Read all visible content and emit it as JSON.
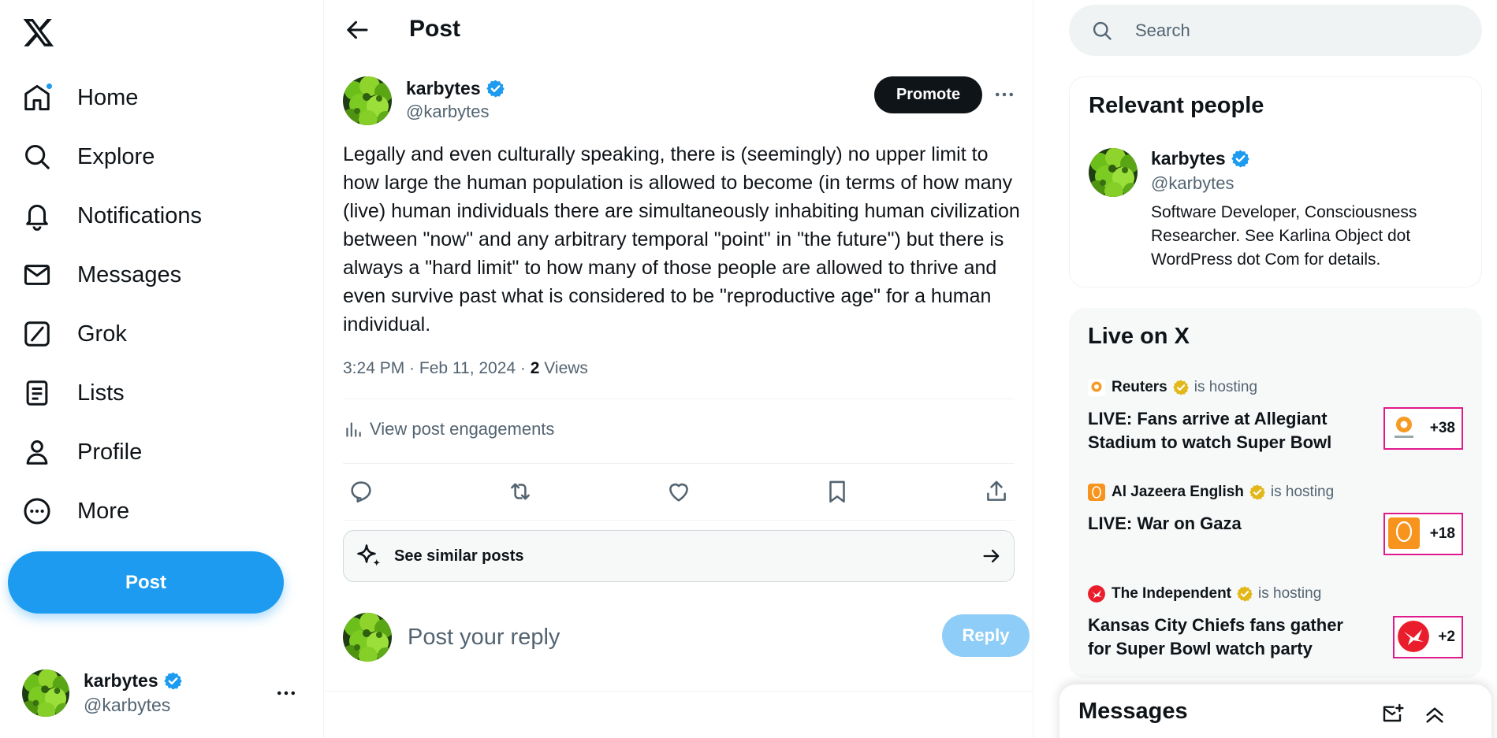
{
  "nav": {
    "items": [
      {
        "label": "Home",
        "icon": "home-icon",
        "badge": true
      },
      {
        "label": "Explore",
        "icon": "search-icon"
      },
      {
        "label": "Notifications",
        "icon": "bell-icon"
      },
      {
        "label": "Messages",
        "icon": "envelope-icon"
      },
      {
        "label": "Grok",
        "icon": "grok-icon"
      },
      {
        "label": "Lists",
        "icon": "list-icon"
      },
      {
        "label": "Profile",
        "icon": "person-icon"
      },
      {
        "label": "More",
        "icon": "more-circle-icon"
      }
    ],
    "post_label": "Post"
  },
  "account": {
    "name": "karbytes",
    "handle": "@karbytes"
  },
  "header": {
    "title": "Post"
  },
  "post": {
    "author_name": "karbytes",
    "author_handle": "@karbytes",
    "promote_label": "Promote",
    "text": "Legally and even culturally speaking, there is (seemingly) no upper limit to how large the human population is allowed to become (in terms of how many (live) human individuals there are simultaneously inhabiting human civilization between \"now\" and any arbitrary temporal \"point\" in \"the future\") but there is always a \"hard limit\" to how many of those people are allowed to thrive and even survive past what is considered to be \"reproductive age\" for a human individual.",
    "timestamp": "3:24 PM · Feb 11, 2024 · ",
    "views_count": "2",
    "views_label": " Views",
    "engagements_label": "View post engagements",
    "similar_label": "See similar posts"
  },
  "reply": {
    "placeholder": "Post your reply",
    "button_label": "Reply"
  },
  "search": {
    "placeholder": "Search"
  },
  "relevant_people": {
    "title": "Relevant people",
    "name": "karbytes",
    "handle": "@karbytes",
    "bio": "Software Developer, Consciousness Researcher. See Karlina Object dot WordPress dot Com for details."
  },
  "live": {
    "title": "Live on X",
    "items": [
      {
        "host": "Reuters",
        "hosting": "is hosting",
        "title": "LIVE: Fans arrive at Allegiant Stadium to watch Super Bowl",
        "count": "+38"
      },
      {
        "host": "Al Jazeera English",
        "hosting": "is hosting",
        "title": "LIVE: War on Gaza",
        "count": "+18"
      },
      {
        "host": "The Independent",
        "hosting": "is hosting",
        "title": "Kansas City Chiefs fans gather for Super Bowl watch party",
        "count": "+2"
      }
    ]
  },
  "messages": {
    "title": "Messages"
  },
  "colors": {
    "accent": "#1d9bf0",
    "live_border": "#e0198c",
    "gold_badge": "#e2b719"
  }
}
